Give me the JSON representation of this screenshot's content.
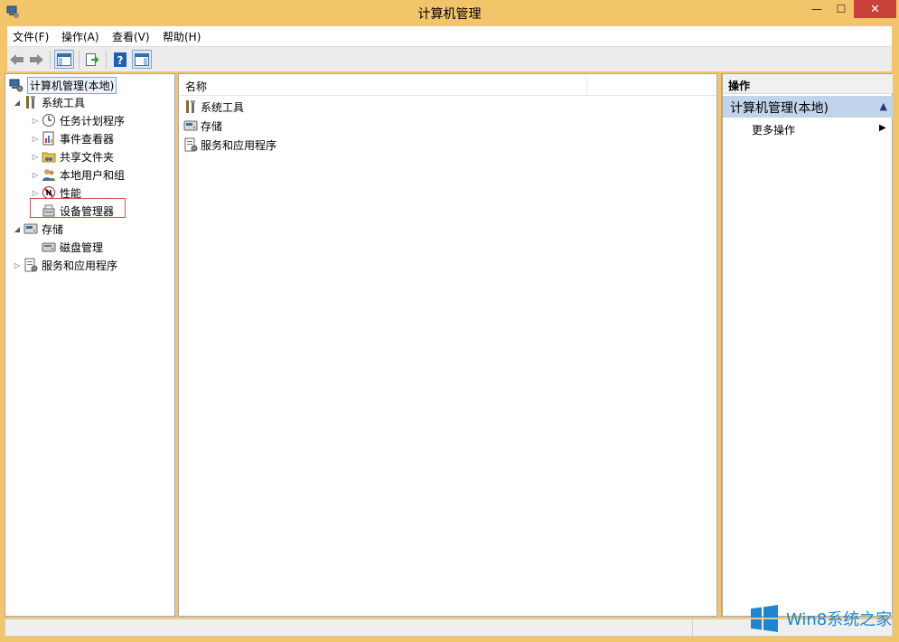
{
  "window": {
    "title": "计算机管理",
    "close_glyph": "✕",
    "max_glyph": "☐",
    "min_glyph": "—"
  },
  "menu": [
    {
      "label": "文件(F)"
    },
    {
      "label": "操作(A)"
    },
    {
      "label": "查看(V)"
    },
    {
      "label": "帮助(H)"
    }
  ],
  "tree": {
    "root": "计算机管理(本地)",
    "system_tools": "系统工具",
    "task_scheduler": "任务计划程序",
    "event_viewer": "事件查看器",
    "shared_folders": "共享文件夹",
    "local_users": "本地用户和组",
    "performance": "性能",
    "device_manager": "设备管理器",
    "storage": "存储",
    "disk_management": "磁盘管理",
    "services_apps": "服务和应用程序"
  },
  "list": {
    "column_name": "名称",
    "items": [
      {
        "label": "系统工具"
      },
      {
        "label": "存储"
      },
      {
        "label": "服务和应用程序"
      }
    ]
  },
  "actions": {
    "header": "操作",
    "section": "计算机管理(本地)",
    "more": "更多操作"
  },
  "watermark": {
    "text": "Win8系统之家"
  },
  "colors": {
    "title_bar": "#f2c56b",
    "close_button": "#c7403a",
    "action_section": "#c2d4eb",
    "highlight_box": "#d9534f"
  }
}
